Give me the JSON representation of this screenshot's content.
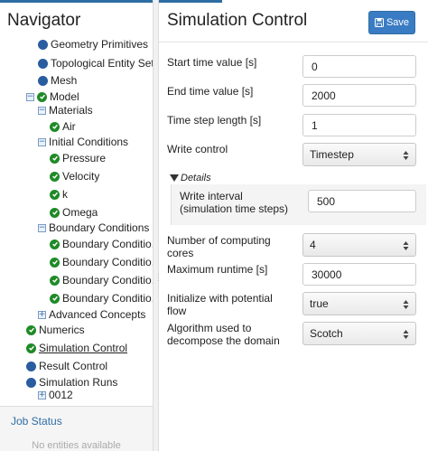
{
  "navigator": {
    "title": "Navigator",
    "tree": [
      {
        "label": "Geometry Primitives",
        "icon": "dot",
        "expander": "none"
      },
      {
        "label": "Topological Entity Sets",
        "icon": "dot",
        "expander": "none"
      },
      {
        "label": "Mesh",
        "icon": "dot",
        "expander": "none"
      },
      {
        "label": "Model",
        "icon": "check",
        "expander": "minus"
      },
      {
        "label": "Materials",
        "icon": "none",
        "expander": "minus"
      },
      {
        "label": "Air",
        "icon": "check",
        "expander": "none"
      },
      {
        "label": "Initial Conditions",
        "icon": "none",
        "expander": "minus"
      },
      {
        "label": "Pressure",
        "icon": "check",
        "expander": "none"
      },
      {
        "label": "Velocity",
        "icon": "check",
        "expander": "none"
      },
      {
        "label": "k",
        "icon": "check",
        "expander": "none"
      },
      {
        "label": "Omega",
        "icon": "check",
        "expander": "none"
      },
      {
        "label": "Boundary Conditions",
        "icon": "none",
        "expander": "minus"
      },
      {
        "label": "Boundary Conditio...",
        "icon": "check",
        "expander": "none"
      },
      {
        "label": "Boundary Conditio...",
        "icon": "check",
        "expander": "none"
      },
      {
        "label": "Boundary Conditio...",
        "icon": "check",
        "expander": "none"
      },
      {
        "label": "Boundary Conditio...",
        "icon": "check",
        "expander": "none"
      },
      {
        "label": "Advanced Concepts",
        "icon": "none",
        "expander": "plus"
      },
      {
        "label": "Numerics",
        "icon": "check",
        "expander": "none"
      },
      {
        "label": "Simulation Control",
        "icon": "check",
        "expander": "none"
      },
      {
        "label": "Result Control",
        "icon": "dot",
        "expander": "none"
      },
      {
        "label": "Simulation Runs",
        "icon": "dot",
        "expander": "none"
      },
      {
        "label": "0012",
        "icon": "none",
        "expander": "plus"
      }
    ],
    "job_status": {
      "title": "Job Status",
      "empty_text": "No entities available"
    }
  },
  "panel": {
    "title": "Simulation Control",
    "save_label": "Save",
    "fields": {
      "start_time": {
        "label": "Start time value [s]",
        "value": "0"
      },
      "end_time": {
        "label": "End time value [s]",
        "value": "2000"
      },
      "time_step": {
        "label": "Time step length [s]",
        "value": "1"
      },
      "write_control": {
        "label": "Write control",
        "value": "Timestep"
      },
      "details_label": "Details",
      "write_interval": {
        "label_line1": "Write interval",
        "label_line2": "(simulation time steps)",
        "value": "500"
      },
      "cores": {
        "label_line1": "Number of computing",
        "label_line2": "cores",
        "value": "4"
      },
      "max_runtime": {
        "label": "Maximum runtime [s]",
        "value": "30000"
      },
      "potential_flow": {
        "label_line1": "Initialize with potential",
        "label_line2": "flow",
        "value": "true"
      },
      "algorithm": {
        "label_line1": "Algorithm used to",
        "label_line2": "decompose the domain",
        "value": "Scotch"
      }
    }
  },
  "colors": {
    "accent": "#2e6da4",
    "save_button": "#3a7cc3",
    "check_green": "#1f8a27",
    "dot_blue": "#2a5ca0"
  }
}
